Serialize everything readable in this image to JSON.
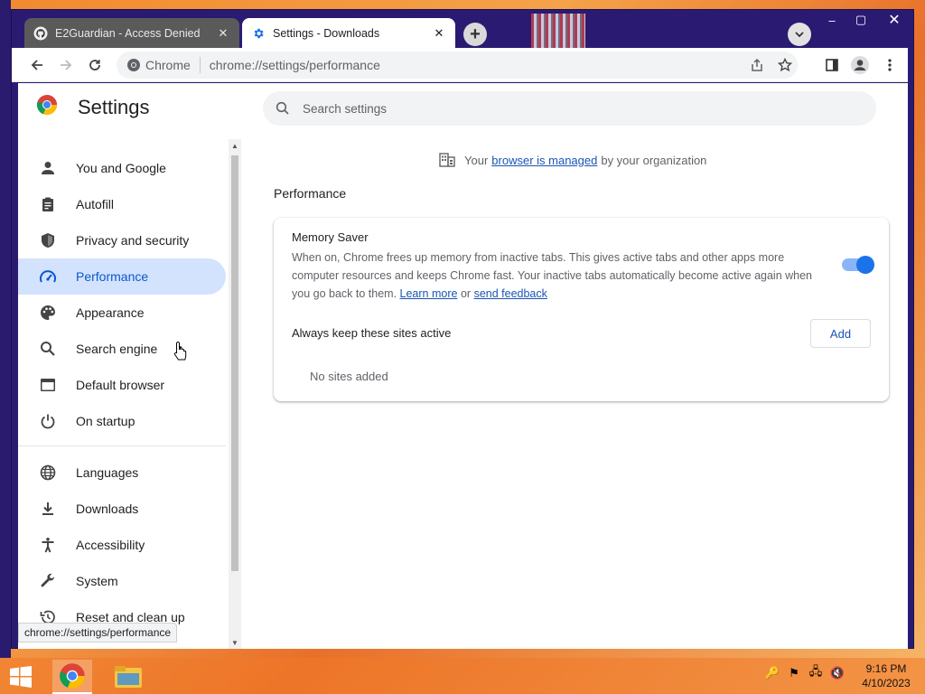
{
  "tabs": [
    {
      "title": "E2Guardian - Access Denied",
      "icon": "github-icon",
      "active": false
    },
    {
      "title": "Settings - Downloads",
      "icon": "gear-icon",
      "active": true
    }
  ],
  "toolbar": {
    "site_label": "Chrome",
    "url": "chrome://settings/performance"
  },
  "settings": {
    "title": "Settings",
    "search_placeholder": "Search settings",
    "nav": [
      {
        "label": "You and Google",
        "icon": "person-icon"
      },
      {
        "label": "Autofill",
        "icon": "clipboard-icon"
      },
      {
        "label": "Privacy and security",
        "icon": "shield-icon"
      },
      {
        "label": "Performance",
        "icon": "speedometer-icon",
        "selected": true
      },
      {
        "label": "Appearance",
        "icon": "palette-icon"
      },
      {
        "label": "Search engine",
        "icon": "search-icon"
      },
      {
        "label": "Default browser",
        "icon": "browser-icon"
      },
      {
        "label": "On startup",
        "icon": "power-icon"
      },
      {
        "label": "Languages",
        "icon": "globe-icon"
      },
      {
        "label": "Downloads",
        "icon": "download-icon"
      },
      {
        "label": "Accessibility",
        "icon": "accessibility-icon"
      },
      {
        "label": "System",
        "icon": "wrench-icon"
      },
      {
        "label": "Reset and clean up",
        "icon": "history-icon"
      }
    ],
    "managed": {
      "prefix": "Your",
      "link": "browser is managed",
      "suffix": "by your organization"
    },
    "section_title": "Performance",
    "memory_saver": {
      "title": "Memory Saver",
      "description": "When on, Chrome frees up memory from inactive tabs. This gives active tabs and other apps more computer resources and keeps Chrome fast. Your inactive tabs automatically become active again when you go back to them.",
      "learn_more": "Learn more",
      "or": "or",
      "send_feedback": "send feedback",
      "enabled": true
    },
    "keep_active": {
      "label": "Always keep these sites active",
      "add_label": "Add",
      "empty": "No sites added"
    }
  },
  "status_url": "chrome://settings/performance",
  "clock": {
    "time": "9:16 PM",
    "date": "4/10/2023"
  },
  "colors": {
    "accent": "#1a73e8",
    "selected_nav_bg": "#d3e3fd",
    "link": "#1a55b5",
    "titlebar": "#2b1a72"
  }
}
